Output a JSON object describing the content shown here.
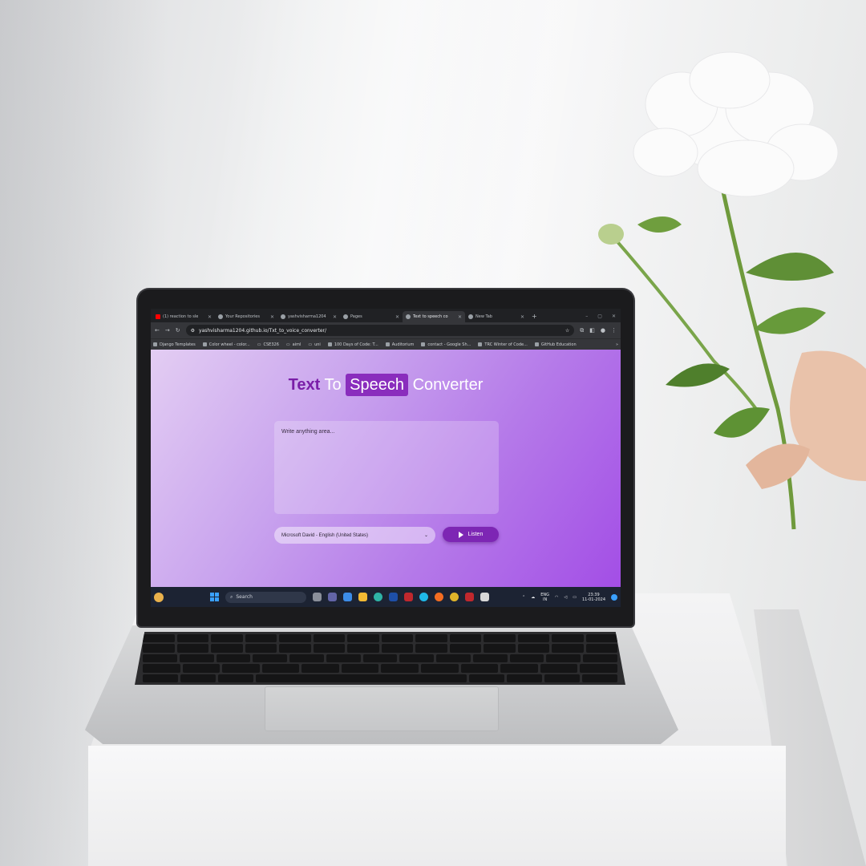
{
  "browser": {
    "tabs": [
      {
        "label": "(1) reaction to sle",
        "icon": "youtube-icon",
        "active": false
      },
      {
        "label": "Your Repositories",
        "icon": "github-icon",
        "active": false
      },
      {
        "label": "yashvisharma1204",
        "icon": "github-icon",
        "active": false
      },
      {
        "label": "Pages",
        "icon": "github-icon",
        "active": false
      },
      {
        "label": "Text to speech co",
        "icon": "globe-icon",
        "active": true
      },
      {
        "label": "New Tab",
        "icon": "chrome-icon",
        "active": false
      }
    ],
    "new_tab_symbol": "+",
    "url": "yashvisharma1204.github.io/Txt_to_voice_converter/",
    "bookmarks": [
      "Django Templates",
      "Color wheel - color...",
      "CSE326",
      "aiml",
      "uni",
      "100 Days of Code: T...",
      "Auditorium",
      "contact - Google Sh...",
      "TRC Winter of Code...",
      "GitHub Education"
    ],
    "bookmarks_more": "»"
  },
  "page": {
    "title_word1": "Text",
    "title_word2": "To",
    "title_word3": "Speech",
    "title_word4": "Converter",
    "textarea_placeholder": "Write anything area...",
    "voice_selected": "Microsoft David - English (United States)",
    "listen_label": "Listen",
    "colors": {
      "accent": "#7d26b4",
      "title_highlight": "#8a2dbd",
      "gradient_end": "#a34ee6"
    }
  },
  "taskbar": {
    "search_placeholder": "Search",
    "language_line1": "ENG",
    "language_line2": "IN",
    "time": "23:39",
    "date": "11-01-2024"
  }
}
